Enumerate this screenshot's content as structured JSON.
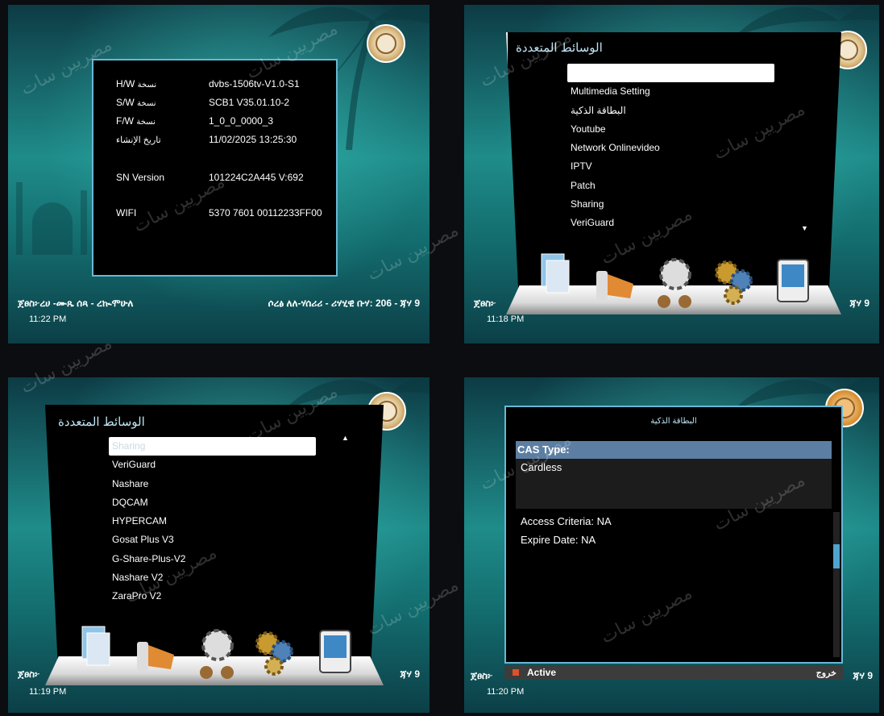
{
  "watermark": "مصريين سات",
  "q1": {
    "rows": [
      {
        "key": "H/W",
        "key_ar": "نسخة",
        "value": "dvbs-1506tv-V1.0-S1"
      },
      {
        "key": "S/W",
        "key_ar": "نسخة",
        "value": "SCB1 V35.01.10-2"
      },
      {
        "key": "F/W",
        "key_ar": "نسخة",
        "value": "1_0_0_0000_3"
      },
      {
        "key": "",
        "key_ar": "تاريخ الإنشاء",
        "value": "11/02/2025 13:25:30"
      },
      {
        "key": "SN Version",
        "key_ar": "",
        "value": "101224C2A445  V:692"
      },
      {
        "key": "WIFI",
        "key_ar": "",
        "value": "5370 7601   00112233FF00"
      }
    ],
    "strip_left": "ጀፀስ፦ረሀ -ሙጼ ሰጻ - ረኲሞሁለ",
    "strip_right": "ሶረፅ ለለ-ሃሰሪሪ - ሪሃሂዊ ቡሃ: 206 - ጃሃ 9",
    "clock": "11:22 PM"
  },
  "q2": {
    "title": "الوسائط المتعددة",
    "items": [
      "",
      "Multimedia Setting",
      "البطاقة الذكية",
      "Youtube",
      "Network Onlinevideo",
      "IPTV",
      "Patch",
      "Sharing",
      "VeriGuard"
    ],
    "selected_index": 0,
    "strip_left": "ጀፀስ፦",
    "strip_right": "ጃሃ 9",
    "clock": "11:18 PM"
  },
  "q3": {
    "title": "الوسائط المتعددة",
    "items": [
      "Sharing",
      "VeriGuard",
      "Nashare",
      "DQCAM",
      "HYPERCAM",
      "Gosat Plus V3",
      "G-Share-Plus-V2",
      "Nashare V2",
      "ZaraPro V2"
    ],
    "selected_index": 0,
    "strip_left": "ጀፀስ፦",
    "strip_right": "ጃሃ 9",
    "clock": "11:19 PM"
  },
  "q4": {
    "title": "البطاقة الذكية",
    "cas_label": "CAS Type:",
    "cas_value": "Cardless",
    "access": "Access Criteria: NA",
    "expire": "Expire Date: NA",
    "footer_label": "Active",
    "exit_label": "خروج",
    "strip_left": "ጀፀስ፦",
    "strip_right": "ጃሃ 9",
    "clock": "11:20 PM"
  },
  "icons": [
    "pictures-icon",
    "music-icon",
    "film-icon",
    "settings-gears-icon",
    "video-player-icon"
  ]
}
